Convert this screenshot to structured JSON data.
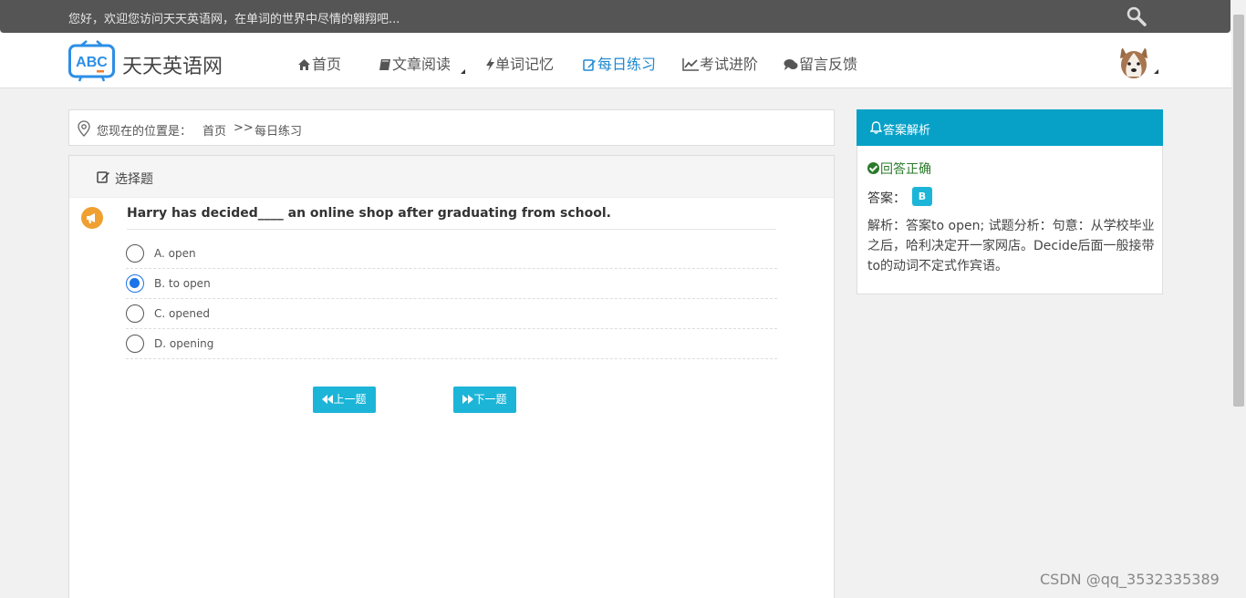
{
  "topbar": {
    "welcome": "您好，欢迎您访问天天英语网，在单词的世界中尽情的翱翔吧...",
    "search_icon": "search-icon"
  },
  "logo": {
    "text": "ABC",
    "brand": "天天英语网"
  },
  "nav": {
    "items": [
      {
        "label": "首页",
        "icon": "home-icon"
      },
      {
        "label": "文章阅读",
        "icon": "book-icon",
        "dropdown": true
      },
      {
        "label": "单词记忆",
        "icon": "bolt-icon"
      },
      {
        "label": "每日练习",
        "icon": "edit-icon",
        "active": true
      },
      {
        "label": "考试进阶",
        "icon": "line-chart-icon"
      },
      {
        "label": "留言反馈",
        "icon": "comments-icon"
      }
    ],
    "avatar_icon": "husky-avatar"
  },
  "breadcrumb": {
    "label": "您现在的位置是：",
    "home": "首页",
    "separator": ">>",
    "current": "每日练习"
  },
  "question": {
    "header": "选择题",
    "text": "Harry has decided____ an online shop after graduating from school.",
    "options": [
      {
        "label": "A. open",
        "checked": false
      },
      {
        "label": "B. to open",
        "checked": true
      },
      {
        "label": "C. opened",
        "checked": false
      },
      {
        "label": "D. opening",
        "checked": false
      }
    ],
    "prev_label": "上一题",
    "next_label": "下一题"
  },
  "answer": {
    "header": "答案解析",
    "status": "回答正确",
    "answer_label": "答案：",
    "answer_value": "B",
    "analysis": "解析：答案to open; 试题分析：句意：从学校毕业之后，哈利决定开一家网店。Decide后面一般接带to的动词不定式作宾语。"
  },
  "watermark": "CSDN @qq_3532335389",
  "colors": {
    "accent": "#1cb5d8",
    "panel_header": "#07a1c8",
    "nav_active": "#1e88d0",
    "success": "#2a7a2a",
    "topbar": "#555555"
  }
}
